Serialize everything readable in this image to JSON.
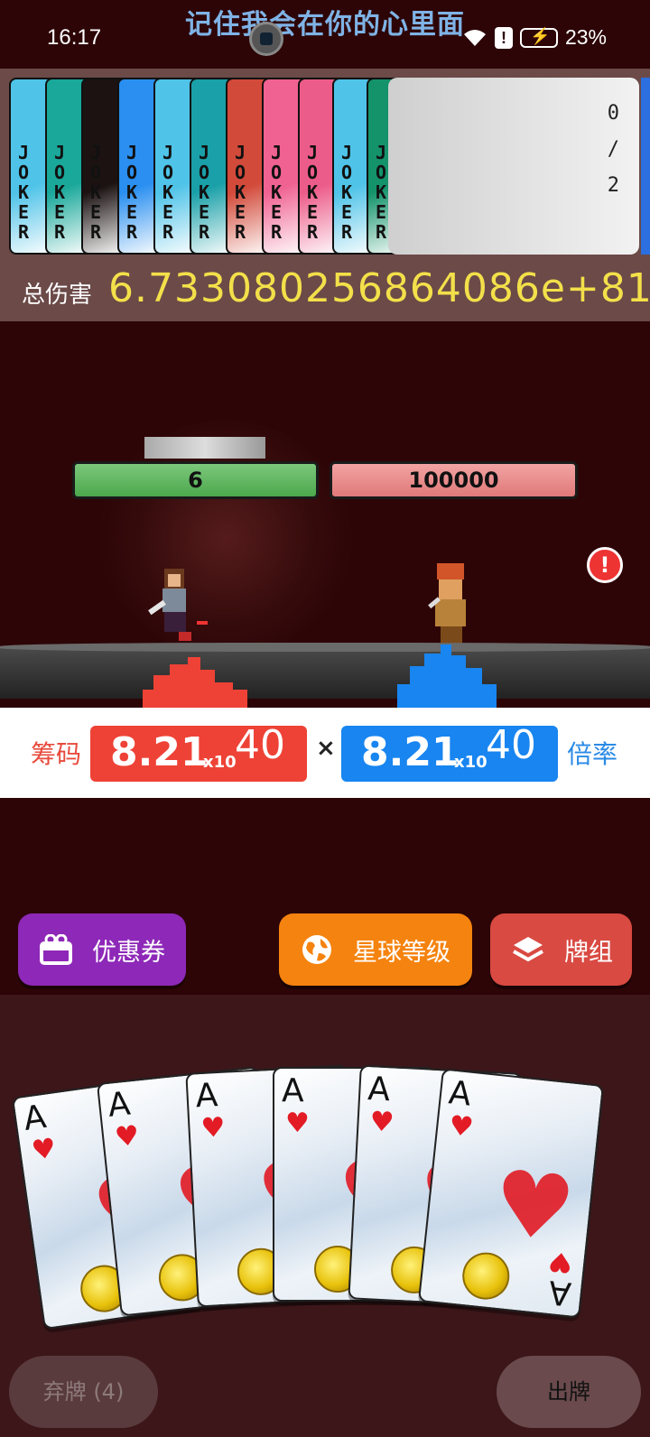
{
  "status_bar": {
    "time": "16:17",
    "marquee": "记住我会在你的心里面",
    "alert": "!",
    "battery": "23%"
  },
  "jokers": {
    "card_text": "JOKER",
    "slots": "0/2",
    "card_colors": [
      "#4fc3e8",
      "#1aa89a",
      "#1c1212",
      "#2a8ff0",
      "#4fc3e8",
      "#1aa0a8",
      "#d24a3a",
      "#f06292",
      "#ec5c8a",
      "#4fc3e8",
      "#14936a"
    ]
  },
  "damage": {
    "label": "总伤害",
    "value": "6.733080256864086e+81"
  },
  "battle": {
    "player_hp": "6",
    "enemy_hp": "100000",
    "warning": "!"
  },
  "score": {
    "chips_label": "筹码",
    "mult_label": "倍率",
    "chips_mantissa": "8.21",
    "chips_base": "x10",
    "chips_exp": "40",
    "mult_mantissa": "8.21",
    "mult_base": "x10",
    "mult_exp": "40",
    "times": "×"
  },
  "buttons": {
    "coupon": "优惠券",
    "planet": "星球等级",
    "deck": "牌组",
    "discard": "弃牌 (4)",
    "play": "出牌"
  },
  "hand": {
    "cards": [
      {
        "rank": "A",
        "suit": "♥"
      },
      {
        "rank": "A",
        "suit": "♥"
      },
      {
        "rank": "A",
        "suit": "♥"
      },
      {
        "rank": "A",
        "suit": "♥"
      },
      {
        "rank": "A",
        "suit": "♥"
      },
      {
        "rank": "A",
        "suit": "♥"
      }
    ]
  },
  "colors": {
    "background": "#2d0507",
    "damage_value": "#f3e04a",
    "chips": "#ee4236",
    "mult": "#1885f0",
    "coupon": "#8e28b8",
    "planet": "#f5830f",
    "deck": "#d94a42"
  }
}
